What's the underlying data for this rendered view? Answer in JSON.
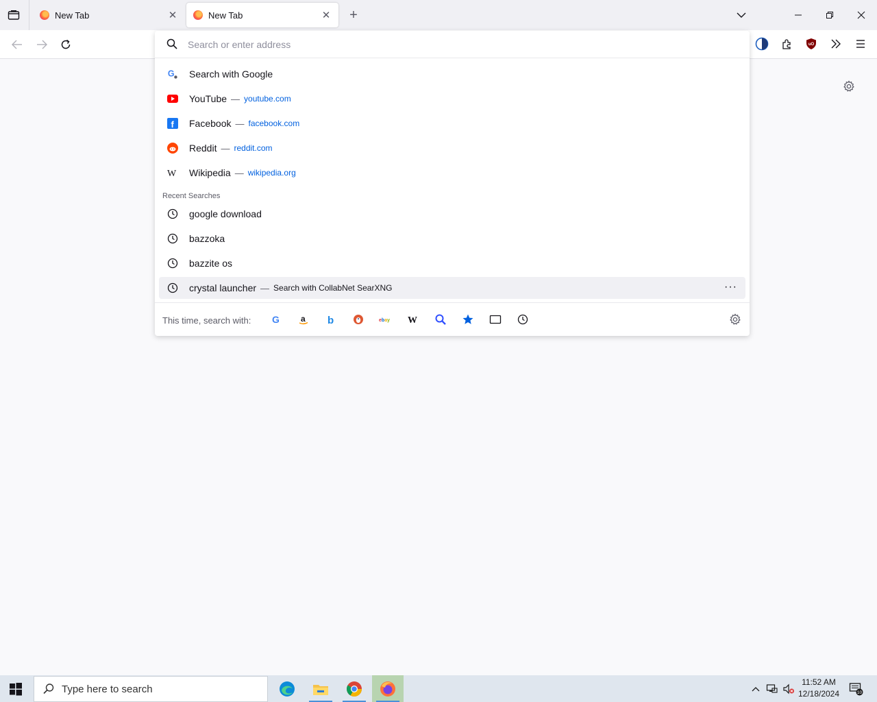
{
  "tabs": [
    {
      "label": "New Tab",
      "close": "✕"
    },
    {
      "label": "New Tab",
      "close": "✕"
    }
  ],
  "new_tab_symbol": "+",
  "urlbar": {
    "placeholder": "Search or enter address",
    "value": ""
  },
  "suggestions": [
    {
      "icon": "google-icon",
      "title": "Search with Google"
    },
    {
      "icon": "youtube-icon",
      "title": "YouTube",
      "separator": "—",
      "url": "youtube.com"
    },
    {
      "icon": "facebook-icon",
      "title": "Facebook",
      "separator": "—",
      "url": "facebook.com"
    },
    {
      "icon": "reddit-icon",
      "title": "Reddit",
      "separator": "—",
      "url": "reddit.com"
    },
    {
      "icon": "wikipedia-icon",
      "title": "Wikipedia",
      "separator": "—",
      "url": "wikipedia.org"
    }
  ],
  "recent_label": "Recent Searches",
  "recent": [
    {
      "icon": "history-icon",
      "title": "google download"
    },
    {
      "icon": "history-icon",
      "title": "bazzoka"
    },
    {
      "icon": "history-icon",
      "title": "bazzite os"
    },
    {
      "icon": "history-icon",
      "title": "crystal launcher",
      "separator": "—",
      "action": "Search with CollabNet SearXNG",
      "more": "···"
    }
  ],
  "oneoff": {
    "label": "This time, search with:",
    "engines": [
      "google-icon",
      "amazon-icon",
      "bing-icon",
      "duckduckgo-icon",
      "ebay-icon",
      "wikipedia-icon",
      "searxng-icon",
      "bookmarks-star-icon",
      "tabs-icon",
      "history-icon"
    ]
  },
  "taskbar": {
    "search_placeholder": "Type here to search",
    "time": "11:52 AM",
    "date": "12/18/2024",
    "notification_count": "10"
  },
  "colors": {
    "accent_link": "#0060df",
    "taskbar_bg": "#dfe6ee",
    "active_app": "#b8d4b0"
  }
}
